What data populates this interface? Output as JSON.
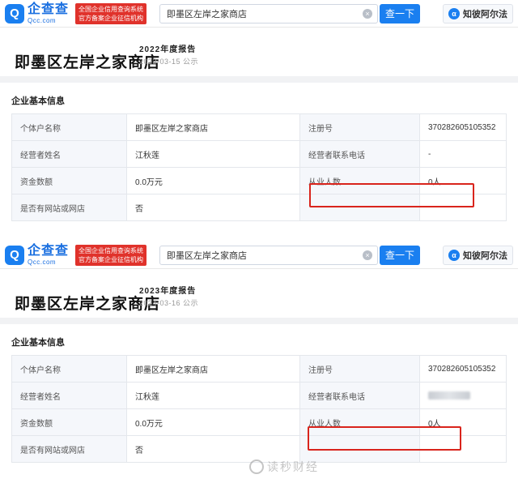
{
  "topbar": {
    "logo_mark": "Q",
    "logo_cn": "企查查",
    "logo_en": "Qcc.com",
    "badge_line1": "全国企业信用查询系统",
    "badge_line2": "官方备案企业征信机构",
    "search_value": "即墨区左岸之家商店",
    "search_button": "查一下",
    "zhibi_label": "知彼阿尔法"
  },
  "reports": [
    {
      "company_name": "即墨区左岸之家商店",
      "report_tag": "2022年度报告",
      "report_date": "2023-03-15 公示",
      "section_title": "企业基本信息",
      "rows": [
        [
          "个体户名称",
          "即墨区左岸之家商店",
          "注册号",
          "370282605105352"
        ],
        [
          "经营者姓名",
          "江秋莲",
          "经营者联系电话",
          "-"
        ],
        [
          "资金数额",
          "0.0万元",
          "从业人数",
          "0人"
        ],
        [
          "是否有网站或网店",
          "否",
          "",
          ""
        ]
      ]
    },
    {
      "company_name": "即墨区左岸之家商店",
      "report_tag": "2023年度报告",
      "report_date": "2024-03-16 公示",
      "section_title": "企业基本信息",
      "rows": [
        [
          "个体户名称",
          "即墨区左岸之家商店",
          "注册号",
          "370282605105352"
        ],
        [
          "经营者姓名",
          "江秋莲",
          "经营者联系电话",
          ""
        ],
        [
          "资金数额",
          "0.0万元",
          "从业人数",
          "0人"
        ],
        [
          "是否有网站或网店",
          "否",
          "",
          ""
        ]
      ]
    }
  ],
  "watermark": "读秒财经",
  "colors": {
    "brand_blue": "#1a7ff0",
    "badge_red": "#e0322b",
    "highlight_red": "#d9241c"
  }
}
